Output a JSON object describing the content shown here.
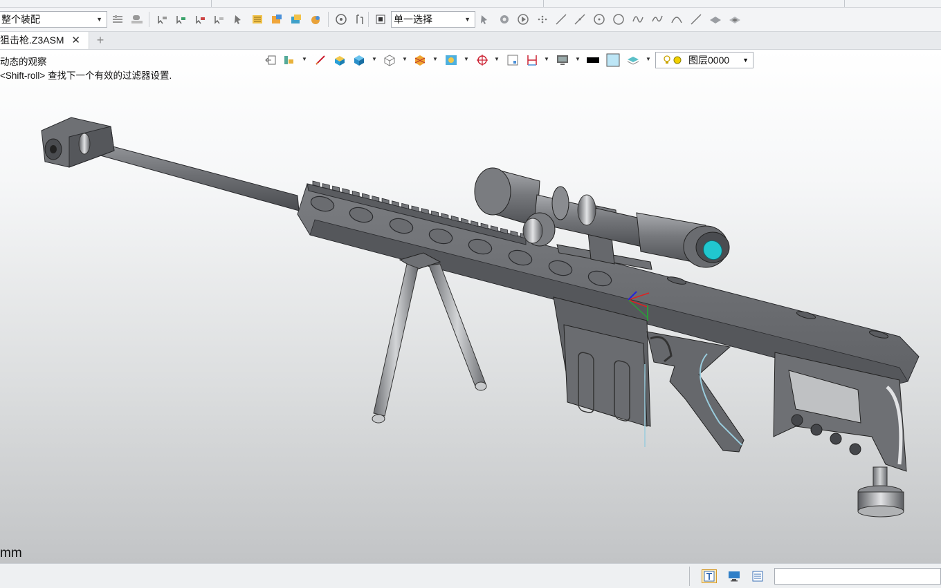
{
  "toolbar": {
    "filter_dropdown": {
      "value": "整个装配"
    },
    "pick_mode_dropdown": {
      "value": "单一选择"
    }
  },
  "tabs": [
    {
      "label": "狙击枪.Z3ASM",
      "close": "✕"
    }
  ],
  "tab_add_label": "+",
  "viewport": {
    "hint_line_1": "动态的观察",
    "hint_line_2": "<Shift-roll> 查找下一个有效的过滤器设置.",
    "layer_dropdown": {
      "value": "图层0000"
    },
    "unit_label": "mm"
  },
  "colors": {
    "model_gray": "#6f7175",
    "edge": "#2a2b2e",
    "lens_cyan": "#21c7cf",
    "background_top": "#ffffff",
    "background_bottom": "#c2c4c6"
  },
  "status_bar": {
    "input_value": ""
  }
}
